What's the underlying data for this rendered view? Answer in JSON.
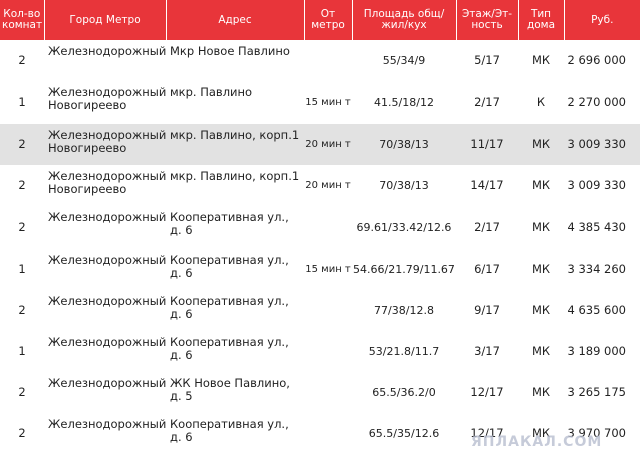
{
  "header": {
    "rooms": "Кол-во комнат",
    "metro": "Город Метро",
    "address": "Адрес",
    "distance": "От метро",
    "area": "Площадь общ/жил/кух",
    "floor": "Этаж/Эт-ность",
    "house_type": "Тип дома",
    "price": "Руб."
  },
  "rows": [
    {
      "rooms": "2",
      "metro": "Железнодорожный",
      "address": "Мкр Новое Павлино",
      "distance": "",
      "area": "55/34/9",
      "floor": "5/17",
      "type": "МК",
      "price": "2 696 000"
    },
    {
      "rooms": "1",
      "metro": "Железнодорожный Новогиреево",
      "address": "мкр. Павлино",
      "distance": "15 мин т",
      "area": "41.5/18/12",
      "floor": "2/17",
      "type": "К",
      "price": "2 270 000"
    },
    {
      "rooms": "2",
      "metro": "Железнодорожный Новогиреево",
      "address": "мкр. Павлино, корп.1",
      "distance": "20 мин т",
      "area": "70/38/13",
      "floor": "11/17",
      "type": "МК",
      "price": "3 009 330"
    },
    {
      "rooms": "2",
      "metro": "Железнодорожный Новогиреево",
      "address": "мкр. Павлино, корп.1",
      "distance": "20 мин т",
      "area": "70/38/13",
      "floor": "14/17",
      "type": "МК",
      "price": "3 009 330"
    },
    {
      "rooms": "2",
      "metro": "Железнодорожный",
      "address": "Кооперативная ул., д. 6",
      "distance": "",
      "area": "69.61/33.42/12.6",
      "floor": "2/17",
      "type": "МК",
      "price": "4 385 430"
    },
    {
      "rooms": "1",
      "metro": "Железнодорожный",
      "address": "Кооперативная ул., д. 6",
      "distance": "15 мин т",
      "area": "54.66/21.79/11.67",
      "floor": "6/17",
      "type": "МК",
      "price": "3 334 260"
    },
    {
      "rooms": "2",
      "metro": "Железнодорожный",
      "address": "Кооперативная ул., д. 6",
      "distance": "",
      "area": "77/38/12.8",
      "floor": "9/17",
      "type": "МК",
      "price": "4 635 600"
    },
    {
      "rooms": "1",
      "metro": "Железнодорожный",
      "address": "Кооперативная ул., д. 6",
      "distance": "",
      "area": "53/21.8/11.7",
      "floor": "3/17",
      "type": "МК",
      "price": "3 189 000"
    },
    {
      "rooms": "2",
      "metro": "Железнодорожный",
      "address": "ЖК Новое Павлино, д. 5",
      "distance": "",
      "area": "65.5/36.2/0",
      "floor": "12/17",
      "type": "МК",
      "price": "3 265 175"
    },
    {
      "rooms": "2",
      "metro": "Железнодорожный",
      "address": "Кооперативная ул., д. 6",
      "distance": "",
      "area": "65.5/35/12.6",
      "floor": "12/17",
      "type": "МК",
      "price": "3 970 700"
    }
  ],
  "highlighted_row": 2,
  "watermark": "ЯПЛАКАЛ.COM",
  "colors": {
    "header_bg": "#e8353a",
    "highlight_bg": "#e2e2e2"
  }
}
